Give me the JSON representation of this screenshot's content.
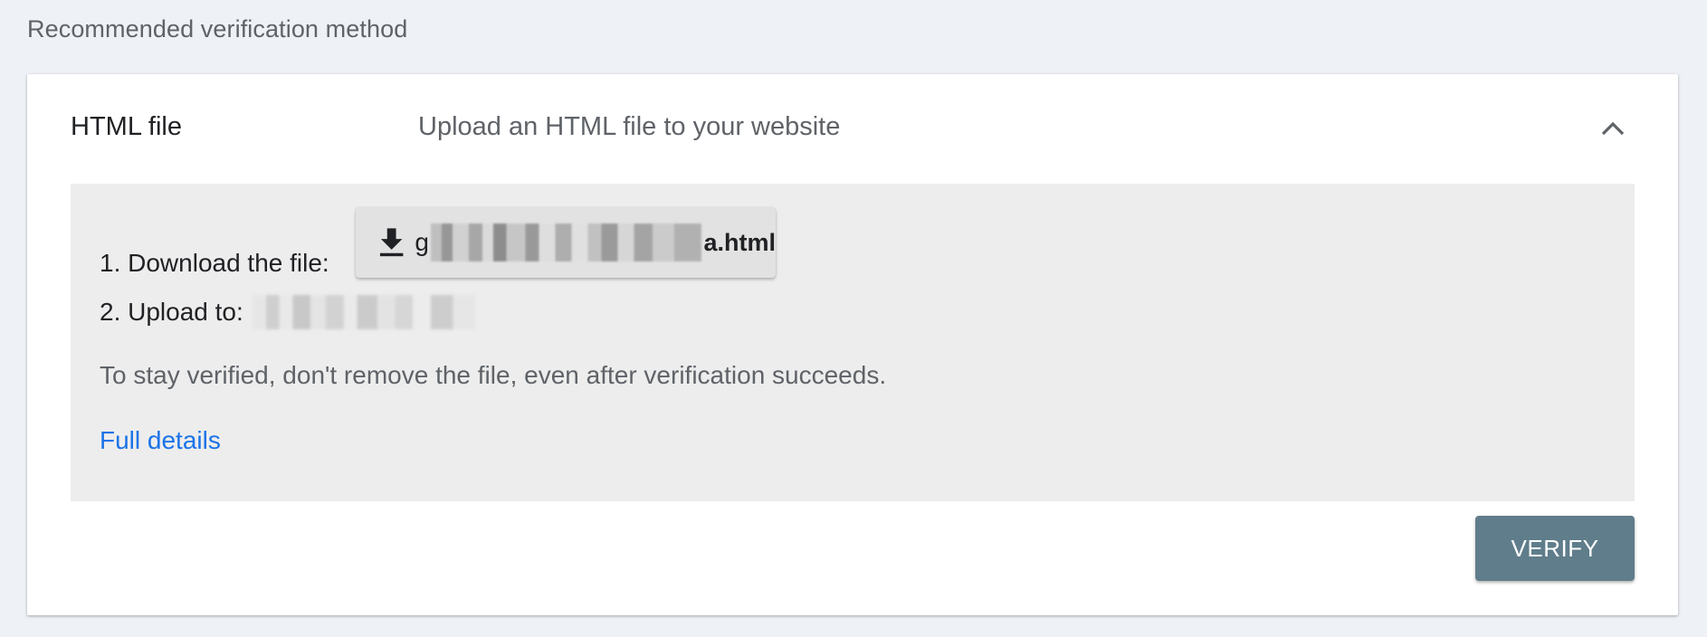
{
  "section": {
    "label": "Recommended verification method"
  },
  "method": {
    "title": "HTML file",
    "description": "Upload an HTML file to your website",
    "expanded": true,
    "collapse_icon": "chevron-up-icon"
  },
  "steps": {
    "download_label": "1. Download the file:",
    "download_icon": "download-icon",
    "file_name_visible_start": "g",
    "file_name_visible_end": "a.html",
    "upload_label": "2. Upload to:"
  },
  "note": "To stay verified, don't remove the file, even after verification succeeds.",
  "links": {
    "full_details": "Full details"
  },
  "actions": {
    "verify_label": "VERIFY"
  },
  "colors": {
    "background": "#eef1f5",
    "panel": "#ededed",
    "link": "#1a73e8",
    "verify_button": "#607d8b"
  }
}
